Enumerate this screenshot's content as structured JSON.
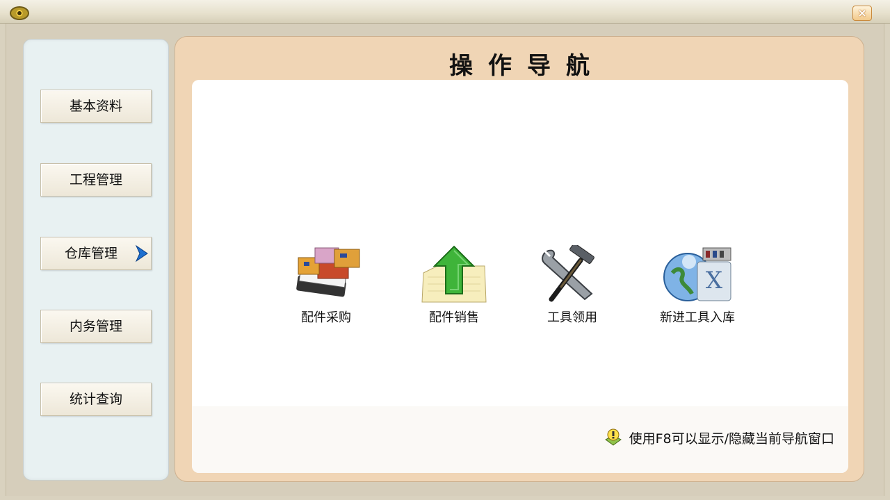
{
  "window": {
    "close_glyph": "×"
  },
  "sidebar": {
    "items": [
      {
        "label": "基本资料",
        "active": false
      },
      {
        "label": "工程管理",
        "active": false
      },
      {
        "label": "仓库管理",
        "active": true
      },
      {
        "label": "内务管理",
        "active": false
      },
      {
        "label": "统计查询",
        "active": false
      }
    ]
  },
  "main": {
    "title": "操作导航",
    "shortcuts": [
      {
        "label": "配件采购",
        "icon": "boxes-icon"
      },
      {
        "label": "配件销售",
        "icon": "green-up-arrow-icon"
      },
      {
        "label": "工具领用",
        "icon": "wrench-hammer-icon"
      },
      {
        "label": "新进工具入库",
        "icon": "globe-x-icon"
      }
    ],
    "hint": "使用F8可以显示/隐藏当前导航窗口"
  },
  "colors": {
    "panel_bg": "#f0d5b5",
    "sidebar_bg": "#e8f1f2",
    "active_arrow": "#1e6fd0"
  }
}
